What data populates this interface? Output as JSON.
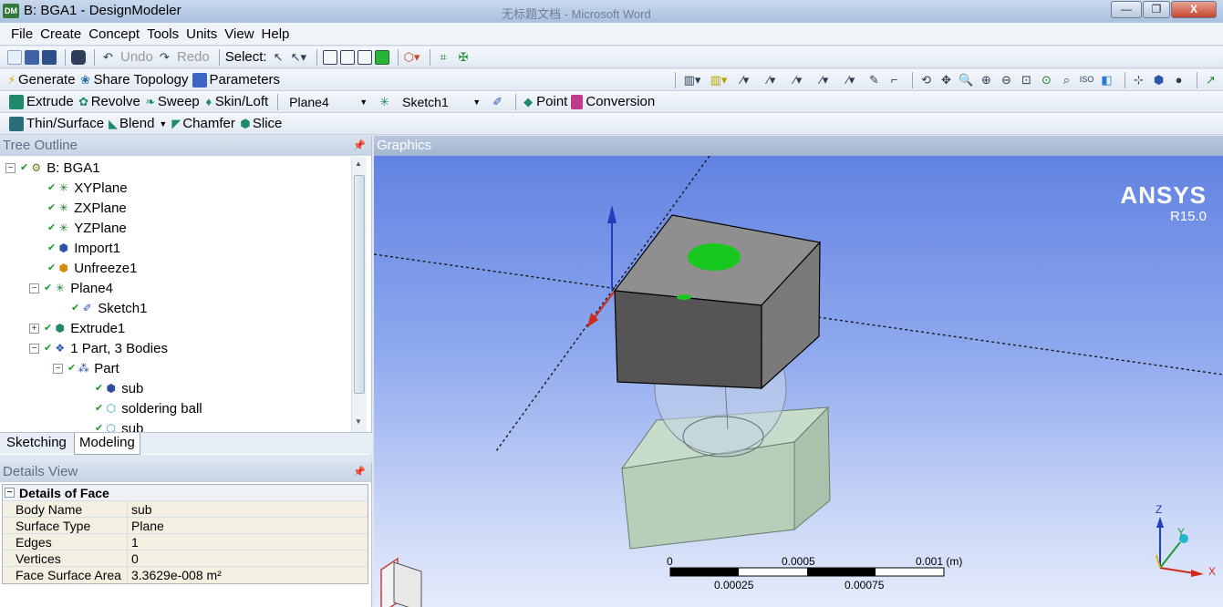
{
  "window": {
    "title": "B: BGA1 - DesignModeler",
    "app_icon": "DM",
    "background_title": "无标题文档 - Microsoft Word",
    "controls": {
      "minimize": "—",
      "maximize": "❐",
      "close": "X"
    }
  },
  "menu": [
    "File",
    "Create",
    "Concept",
    "Tools",
    "Units",
    "View",
    "Help"
  ],
  "toolbar1": {
    "undo": "Undo",
    "redo": "Redo",
    "select_label": "Select:"
  },
  "toolbar2": {
    "generate": "Generate",
    "share_topology": "Share Topology",
    "parameters": "Parameters"
  },
  "toolbar3": {
    "extrude": "Extrude",
    "revolve": "Revolve",
    "sweep": "Sweep",
    "skin_loft": "Skin/Loft",
    "plane_combo": "Plane4",
    "sketch_combo": "Sketch1",
    "point": "Point",
    "conversion": "Conversion"
  },
  "toolbar4": {
    "thin_surface": "Thin/Surface",
    "blend": "Blend",
    "chamfer": "Chamfer",
    "slice": "Slice"
  },
  "tree": {
    "header": "Tree Outline",
    "nodes": [
      {
        "label": "B: BGA1",
        "icon": "model-icon"
      },
      {
        "label": "XYPlane",
        "icon": "plane-icon"
      },
      {
        "label": "ZXPlane",
        "icon": "plane-icon"
      },
      {
        "label": "YZPlane",
        "icon": "plane-icon"
      },
      {
        "label": "Import1",
        "icon": "import-icon"
      },
      {
        "label": "Unfreeze1",
        "icon": "unfreeze-icon"
      },
      {
        "label": "Plane4",
        "icon": "plane-icon"
      },
      {
        "label": "Sketch1",
        "icon": "sketch-icon"
      },
      {
        "label": "Extrude1",
        "icon": "extrude-icon"
      },
      {
        "label": "1 Part, 3 Bodies",
        "icon": "bodies-icon"
      },
      {
        "label": "Part",
        "icon": "part-icon"
      },
      {
        "label": "sub",
        "icon": "solid-body-icon"
      },
      {
        "label": "soldering ball",
        "icon": "frozen-body-icon"
      },
      {
        "label": "sub",
        "icon": "frozen-body-icon"
      }
    ],
    "tabs": [
      "Sketching",
      "Modeling"
    ]
  },
  "details": {
    "header": "Details View",
    "section": "Details of Face",
    "rows": [
      {
        "key": "Body Name",
        "value": "sub"
      },
      {
        "key": "Surface Type",
        "value": "Plane"
      },
      {
        "key": "Edges",
        "value": "1"
      },
      {
        "key": "Vertices",
        "value": "0"
      },
      {
        "key": "Face Surface Area",
        "value": "3.3629e-008 m²"
      }
    ]
  },
  "graphics": {
    "header": "Graphics",
    "logo": "ANSYS",
    "version": "R15.0",
    "scale": {
      "top_labels": [
        "0",
        "0.0005",
        "0.001 (m)"
      ],
      "bottom_labels": [
        "0.00025",
        "0.00075"
      ]
    },
    "triad": {
      "x": "X",
      "y": "Y",
      "z": "Z"
    },
    "colors": {
      "selection": "#19c81e",
      "background_top": "#5d7ee0",
      "background_bottom": "#e4ebfb"
    }
  }
}
